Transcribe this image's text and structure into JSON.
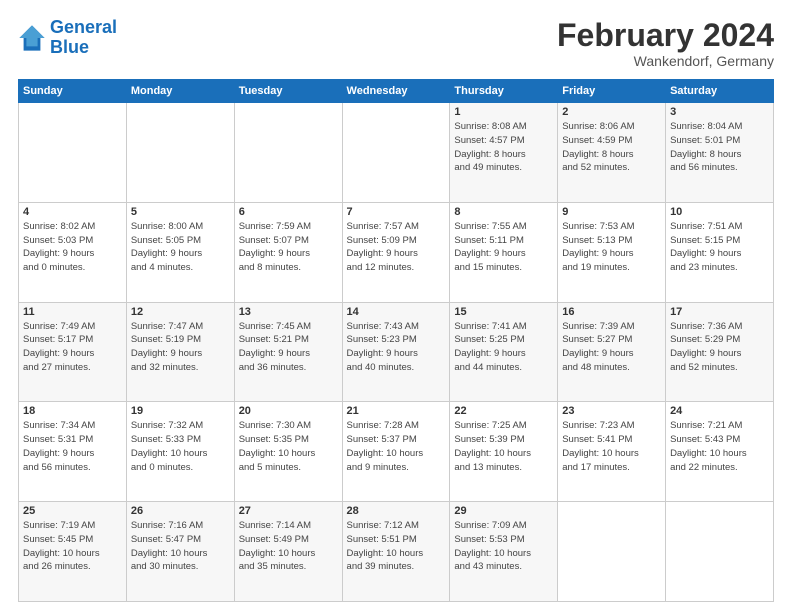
{
  "header": {
    "logo_line1": "General",
    "logo_line2": "Blue",
    "title": "February 2024",
    "subtitle": "Wankendorf, Germany"
  },
  "weekdays": [
    "Sunday",
    "Monday",
    "Tuesday",
    "Wednesday",
    "Thursday",
    "Friday",
    "Saturday"
  ],
  "weeks": [
    [
      {
        "day": "",
        "info": ""
      },
      {
        "day": "",
        "info": ""
      },
      {
        "day": "",
        "info": ""
      },
      {
        "day": "",
        "info": ""
      },
      {
        "day": "1",
        "info": "Sunrise: 8:08 AM\nSunset: 4:57 PM\nDaylight: 8 hours\nand 49 minutes."
      },
      {
        "day": "2",
        "info": "Sunrise: 8:06 AM\nSunset: 4:59 PM\nDaylight: 8 hours\nand 52 minutes."
      },
      {
        "day": "3",
        "info": "Sunrise: 8:04 AM\nSunset: 5:01 PM\nDaylight: 8 hours\nand 56 minutes."
      }
    ],
    [
      {
        "day": "4",
        "info": "Sunrise: 8:02 AM\nSunset: 5:03 PM\nDaylight: 9 hours\nand 0 minutes."
      },
      {
        "day": "5",
        "info": "Sunrise: 8:00 AM\nSunset: 5:05 PM\nDaylight: 9 hours\nand 4 minutes."
      },
      {
        "day": "6",
        "info": "Sunrise: 7:59 AM\nSunset: 5:07 PM\nDaylight: 9 hours\nand 8 minutes."
      },
      {
        "day": "7",
        "info": "Sunrise: 7:57 AM\nSunset: 5:09 PM\nDaylight: 9 hours\nand 12 minutes."
      },
      {
        "day": "8",
        "info": "Sunrise: 7:55 AM\nSunset: 5:11 PM\nDaylight: 9 hours\nand 15 minutes."
      },
      {
        "day": "9",
        "info": "Sunrise: 7:53 AM\nSunset: 5:13 PM\nDaylight: 9 hours\nand 19 minutes."
      },
      {
        "day": "10",
        "info": "Sunrise: 7:51 AM\nSunset: 5:15 PM\nDaylight: 9 hours\nand 23 minutes."
      }
    ],
    [
      {
        "day": "11",
        "info": "Sunrise: 7:49 AM\nSunset: 5:17 PM\nDaylight: 9 hours\nand 27 minutes."
      },
      {
        "day": "12",
        "info": "Sunrise: 7:47 AM\nSunset: 5:19 PM\nDaylight: 9 hours\nand 32 minutes."
      },
      {
        "day": "13",
        "info": "Sunrise: 7:45 AM\nSunset: 5:21 PM\nDaylight: 9 hours\nand 36 minutes."
      },
      {
        "day": "14",
        "info": "Sunrise: 7:43 AM\nSunset: 5:23 PM\nDaylight: 9 hours\nand 40 minutes."
      },
      {
        "day": "15",
        "info": "Sunrise: 7:41 AM\nSunset: 5:25 PM\nDaylight: 9 hours\nand 44 minutes."
      },
      {
        "day": "16",
        "info": "Sunrise: 7:39 AM\nSunset: 5:27 PM\nDaylight: 9 hours\nand 48 minutes."
      },
      {
        "day": "17",
        "info": "Sunrise: 7:36 AM\nSunset: 5:29 PM\nDaylight: 9 hours\nand 52 minutes."
      }
    ],
    [
      {
        "day": "18",
        "info": "Sunrise: 7:34 AM\nSunset: 5:31 PM\nDaylight: 9 hours\nand 56 minutes."
      },
      {
        "day": "19",
        "info": "Sunrise: 7:32 AM\nSunset: 5:33 PM\nDaylight: 10 hours\nand 0 minutes."
      },
      {
        "day": "20",
        "info": "Sunrise: 7:30 AM\nSunset: 5:35 PM\nDaylight: 10 hours\nand 5 minutes."
      },
      {
        "day": "21",
        "info": "Sunrise: 7:28 AM\nSunset: 5:37 PM\nDaylight: 10 hours\nand 9 minutes."
      },
      {
        "day": "22",
        "info": "Sunrise: 7:25 AM\nSunset: 5:39 PM\nDaylight: 10 hours\nand 13 minutes."
      },
      {
        "day": "23",
        "info": "Sunrise: 7:23 AM\nSunset: 5:41 PM\nDaylight: 10 hours\nand 17 minutes."
      },
      {
        "day": "24",
        "info": "Sunrise: 7:21 AM\nSunset: 5:43 PM\nDaylight: 10 hours\nand 22 minutes."
      }
    ],
    [
      {
        "day": "25",
        "info": "Sunrise: 7:19 AM\nSunset: 5:45 PM\nDaylight: 10 hours\nand 26 minutes."
      },
      {
        "day": "26",
        "info": "Sunrise: 7:16 AM\nSunset: 5:47 PM\nDaylight: 10 hours\nand 30 minutes."
      },
      {
        "day": "27",
        "info": "Sunrise: 7:14 AM\nSunset: 5:49 PM\nDaylight: 10 hours\nand 35 minutes."
      },
      {
        "day": "28",
        "info": "Sunrise: 7:12 AM\nSunset: 5:51 PM\nDaylight: 10 hours\nand 39 minutes."
      },
      {
        "day": "29",
        "info": "Sunrise: 7:09 AM\nSunset: 5:53 PM\nDaylight: 10 hours\nand 43 minutes."
      },
      {
        "day": "",
        "info": ""
      },
      {
        "day": "",
        "info": ""
      }
    ]
  ]
}
